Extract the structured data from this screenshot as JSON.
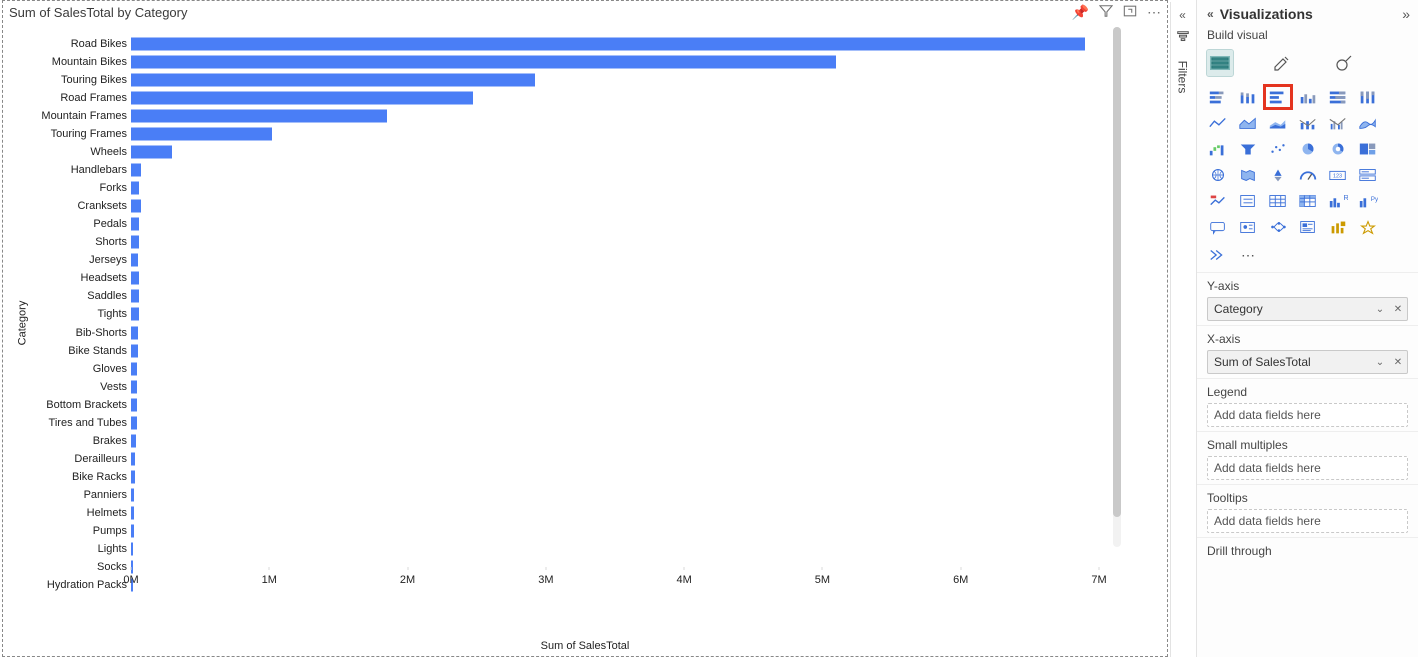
{
  "visual": {
    "title": "Sum of SalesTotal by Category",
    "x_axis_label": "Sum of SalesTotal",
    "y_axis_label": "Category",
    "tools": {
      "pin": "📌",
      "filter_applied": "filter",
      "focus": "focus",
      "more": "⋯"
    }
  },
  "chart_data": {
    "type": "bar",
    "orientation": "horizontal",
    "xlabel": "Sum of SalesTotal",
    "ylabel": "Category",
    "xlim": [
      0,
      7000000
    ],
    "x_ticks": [
      "0M",
      "1M",
      "2M",
      "3M",
      "4M",
      "5M",
      "6M",
      "7M"
    ],
    "categories": [
      "Road Bikes",
      "Mountain Bikes",
      "Touring Bikes",
      "Road Frames",
      "Mountain Frames",
      "Touring Frames",
      "Wheels",
      "Handlebars",
      "Forks",
      "Cranksets",
      "Pedals",
      "Shorts",
      "Jerseys",
      "Headsets",
      "Saddles",
      "Tights",
      "Bib-Shorts",
      "Bike Stands",
      "Gloves",
      "Vests",
      "Bottom Brackets",
      "Tires and Tubes",
      "Brakes",
      "Derailleurs",
      "Bike Racks",
      "Panniers",
      "Helmets",
      "Pumps",
      "Lights",
      "Socks",
      "Hydration Packs"
    ],
    "values": [
      6900000,
      5100000,
      2920000,
      2470000,
      1850000,
      1020000,
      300000,
      75000,
      60000,
      75000,
      60000,
      60000,
      50000,
      60000,
      55000,
      55000,
      50000,
      50000,
      45000,
      45000,
      40000,
      40000,
      35000,
      30000,
      30000,
      25000,
      25000,
      20000,
      18000,
      15000,
      15000
    ]
  },
  "filters_pane": {
    "label": "Filters",
    "collapse_icon": "«"
  },
  "viz_pane": {
    "title": "Visualizations",
    "subtitle": "Build visual",
    "tabs": {
      "build": "Build visual",
      "format": "Format",
      "analytics": "Analytics"
    },
    "expand": "»",
    "gallery_selected": "clustered-bar",
    "gallery": [
      "stacked-bar",
      "stacked-column",
      "clustered-bar",
      "clustered-column",
      "100-stacked-bar",
      "100-stacked-column",
      "line",
      "area",
      "stacked-area",
      "line-stacked-column",
      "line-clustered-column",
      "ribbon",
      "waterfall",
      "funnel",
      "scatter",
      "pie",
      "donut",
      "treemap",
      "map",
      "filled-map",
      "azure-map",
      "gauge",
      "card",
      "multi-row-card",
      "kpi",
      "slicer",
      "table",
      "matrix",
      "r-visual",
      "py-visual",
      "qna",
      "key-influencers",
      "decomposition",
      "smart-narrative",
      "paginated",
      "get-more"
    ],
    "more_row": [
      "power-automate",
      "more-options"
    ],
    "wells": {
      "y_axis": {
        "label": "Y-axis",
        "field": "Category"
      },
      "x_axis": {
        "label": "X-axis",
        "field": "Sum of SalesTotal"
      },
      "legend": {
        "label": "Legend",
        "placeholder": "Add data fields here"
      },
      "small_multiples": {
        "label": "Small multiples",
        "placeholder": "Add data fields here"
      },
      "tooltips": {
        "label": "Tooltips",
        "placeholder": "Add data fields here"
      },
      "drill": {
        "label": "Drill through"
      }
    }
  }
}
